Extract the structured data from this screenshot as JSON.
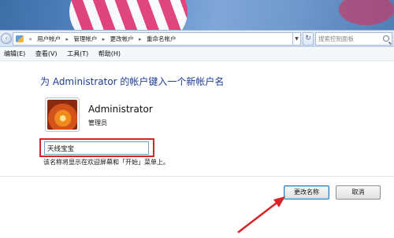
{
  "address_bar": {
    "back_symbol": "‹",
    "forward_symbol": "›",
    "overflow": "«",
    "breadcrumbs": [
      "用户帐户",
      "管理帐户",
      "更改帐户",
      "重命名帐户"
    ],
    "separator": "▸",
    "refresh_symbol": "↻",
    "search_placeholder": "搜索控制面板"
  },
  "menu": {
    "items": [
      "编辑(E)",
      "查看(V)",
      "工具(T)",
      "帮助(H)"
    ]
  },
  "main": {
    "heading": "为 Administrator 的帐户键入一个新帐户名",
    "user": {
      "name": "Administrator",
      "role": "管理员"
    },
    "new_name_value": "天线宝宝",
    "hint": "该名称将显示在欢迎屏幕和「开始」菜单上。"
  },
  "buttons": {
    "rename_label": "更改名称",
    "cancel_label": "取消"
  },
  "colors": {
    "highlight": "#d8232a",
    "heading": "#1e3c96"
  }
}
